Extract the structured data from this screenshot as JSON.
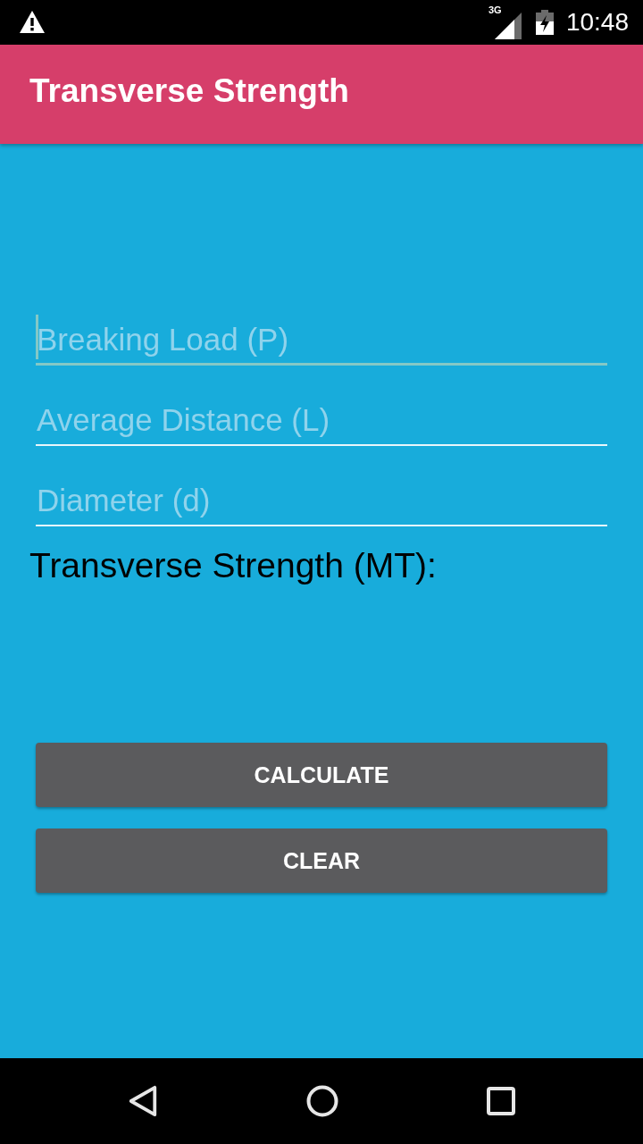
{
  "status_bar": {
    "network": "3G",
    "time": "10:48"
  },
  "app_bar": {
    "title": "Transverse Strength"
  },
  "fields": [
    {
      "placeholder": "Breaking Load (P)",
      "focused": true
    },
    {
      "placeholder": "Average Distance (L)",
      "focused": false
    },
    {
      "placeholder": "Diameter (d)",
      "focused": false
    }
  ],
  "result_label": "Transverse Strength (MT):",
  "buttons": [
    "CALCULATE",
    "CLEAR"
  ]
}
